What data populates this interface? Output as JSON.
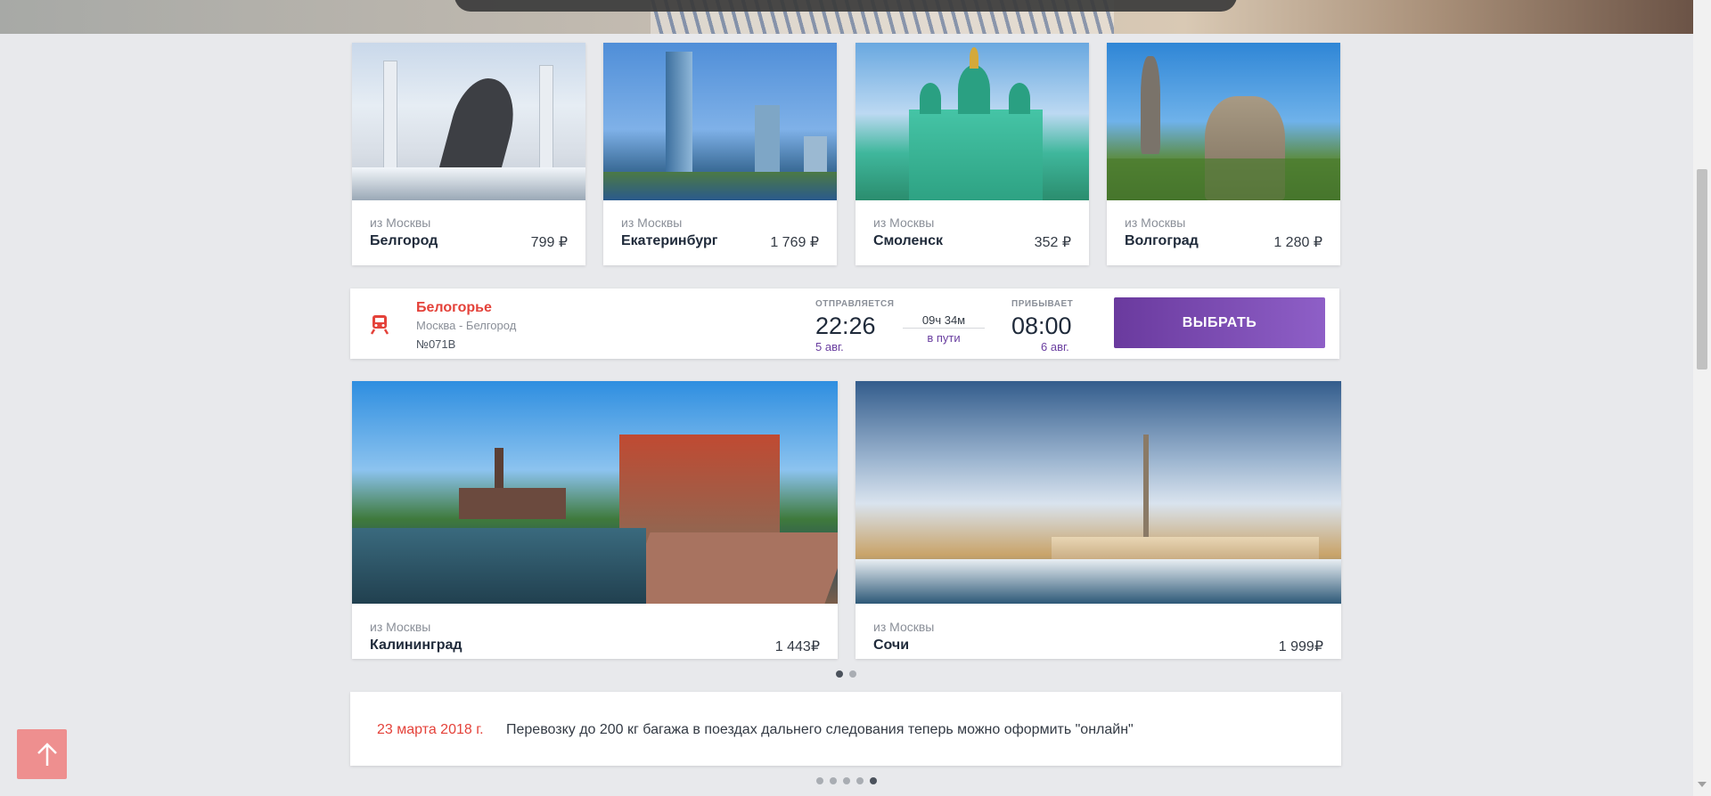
{
  "colors": {
    "accent_red": "#e4423a",
    "accent_purple": "#6a3fa0",
    "button_gradient_start": "#6a3a9e",
    "button_gradient_end": "#8e5fc7",
    "totop_bg": "#ee8f8f"
  },
  "popular_routes": [
    {
      "from": "из Москвы",
      "city": "Белгород",
      "price": "799 ₽"
    },
    {
      "from": "из Москвы",
      "city": "Екатеринбург",
      "price": "1 769 ₽"
    },
    {
      "from": "из Москвы",
      "city": "Смоленск",
      "price": "352 ₽"
    },
    {
      "from": "из Москвы",
      "city": "Волгоград",
      "price": "1 280 ₽"
    }
  ],
  "train": {
    "icon": "train-icon",
    "name": "Белогорье",
    "route": "Москва - Белгород",
    "number": "№071В",
    "departs_label": "ОТПРАВЛЯЕТСЯ",
    "depart_time": "22:26",
    "depart_date": "5 авг.",
    "duration": "09ч 34м",
    "enroute_label": "в пути",
    "arrives_label": "ПРИБЫВАЕТ",
    "arrive_time": "08:00",
    "arrive_date": "6 авг.",
    "choose_label": "ВЫБРАТЬ"
  },
  "featured_routes": [
    {
      "from": "из Москвы",
      "city": "Калининград",
      "price": "1 443₽"
    },
    {
      "from": "из Москвы",
      "city": "Сочи",
      "price": "1 999₽"
    }
  ],
  "carousel": {
    "pages": 2,
    "active": 1
  },
  "news": {
    "date": "23 марта 2018 г.",
    "text": "Перевозку до 200 кг багажа в поездах дальнего следования теперь можно оформить \"онлайн\"",
    "pages": 5,
    "active": 5
  },
  "back_to_top": {
    "icon": "arrow-up-icon"
  }
}
